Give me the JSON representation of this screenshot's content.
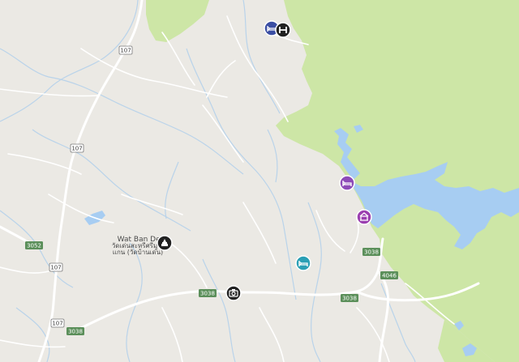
{
  "map": {
    "colors": {
      "land": "#ebe9e4",
      "forest": "#cde6a6",
      "water": "#a7cdf2",
      "major_road": "#ffffff",
      "minor_road": "#ffffff",
      "stream": "#b9d3ea",
      "shield_bg": "#ffffff",
      "shield_border": "#8a8a8a",
      "shield_green_bg": "#5b8f5a"
    },
    "route_shields": [
      {
        "label": "107"
      },
      {
        "label": "107"
      },
      {
        "label": "3052"
      },
      {
        "label": "107"
      },
      {
        "label": "107"
      },
      {
        "label": "3038"
      },
      {
        "label": "3038"
      },
      {
        "label": "3038"
      },
      {
        "label": "3038"
      },
      {
        "label": "4046"
      }
    ],
    "temple": {
      "name_en": "Wat Ban Den",
      "name_th_line1": "วัดเด่นสะหรีศรีมู",
      "name_th_line2": "แกน (วัดบ้านเด่น)",
      "icon": "temple-icon",
      "icon_color": "#222222"
    },
    "poi_icons": [
      {
        "name": "hotel-icon",
        "color": "#3b4ea3"
      },
      {
        "name": "hospital-icon",
        "color": "#222222"
      },
      {
        "name": "hotel-icon",
        "color": "#8d4bb8"
      },
      {
        "name": "resort-icon",
        "color": "#9b3fb0"
      },
      {
        "name": "hotel-icon",
        "color": "#2a9fb5"
      },
      {
        "name": "camera-icon",
        "color": "#222222"
      }
    ]
  }
}
